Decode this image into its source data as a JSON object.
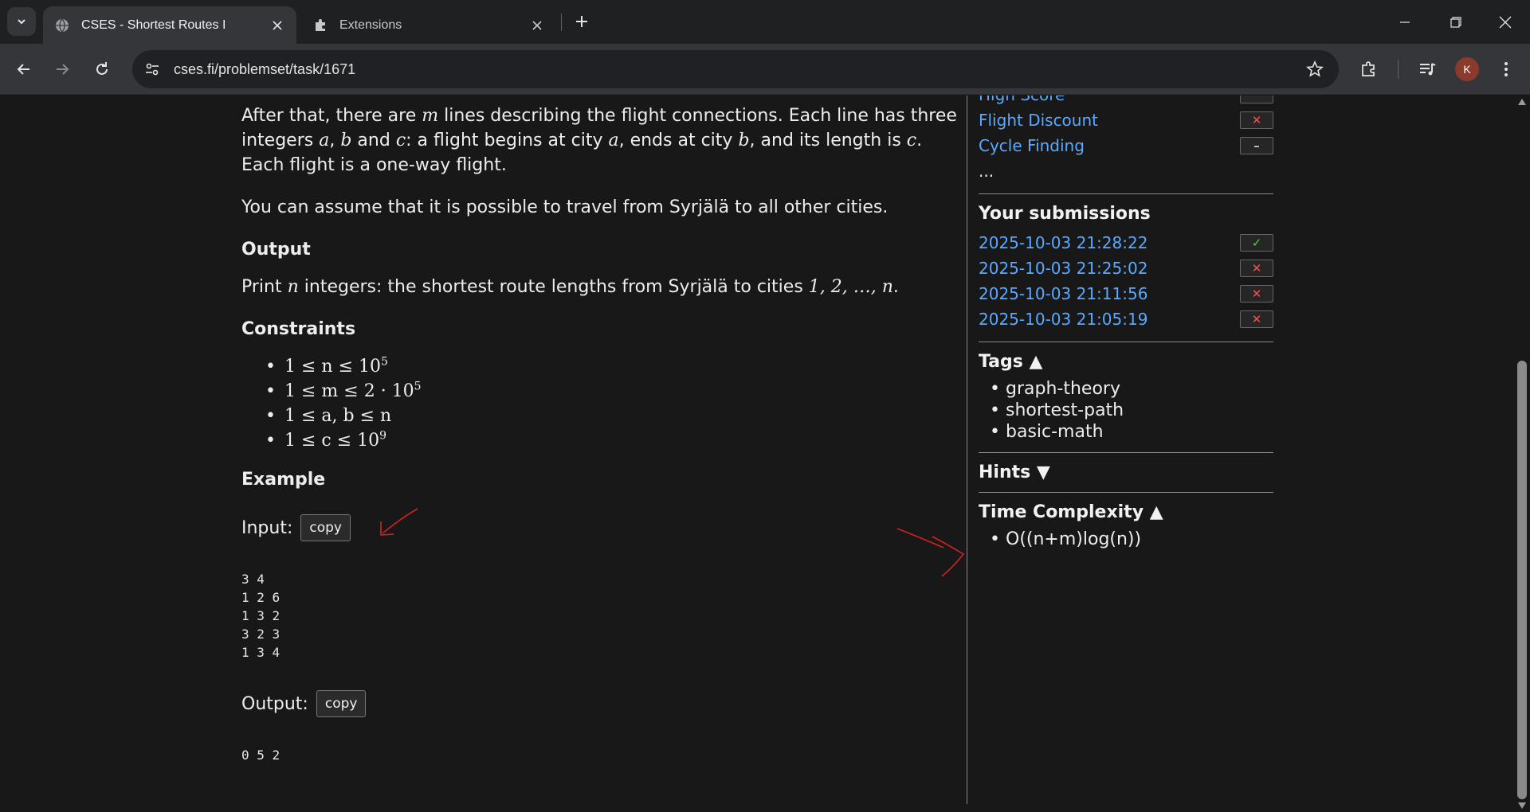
{
  "browser": {
    "tabs": [
      {
        "title": "CSES - Shortest Routes I",
        "active": true
      },
      {
        "title": "Extensions",
        "active": false
      }
    ],
    "url": "cses.fi/problemset/task/1671",
    "profile_initial": "K"
  },
  "content": {
    "para1_a": "After that, there are ",
    "para1_m": "m",
    "para1_b": " lines describing the flight connections. Each line has three integers ",
    "para1_va": "a",
    "para1_c": ", ",
    "para1_vb": "b",
    "para1_d": " and ",
    "para1_vc": "c",
    "para1_e": ": a flight begins at city ",
    "para1_va2": "a",
    "para1_f": ", ends at city ",
    "para1_vb2": "b",
    "para1_g": ", and its length is ",
    "para1_vc2": "c",
    "para1_h": ". Each flight is a one-way flight.",
    "para2": "You can assume that it is possible to travel from Syrjälä to all other cities.",
    "output_heading": "Output",
    "output_a": "Print ",
    "output_n": "n",
    "output_b": " integers: the shortest route lengths from Syrjälä to cities ",
    "output_seq": "1, 2, …, n",
    "output_c": ".",
    "constraints_heading": "Constraints",
    "constraints": [
      {
        "text": "1 ≤ n ≤ 10",
        "sup": "5"
      },
      {
        "text": "1 ≤ m ≤ 2 · 10",
        "sup": "5"
      },
      {
        "text": "1 ≤ a, b ≤ n",
        "sup": ""
      },
      {
        "text": "1 ≤ c ≤ 10",
        "sup": "9"
      }
    ],
    "example_heading": "Example",
    "input_label": "Input:",
    "output_label": "Output:",
    "copy_label": "copy",
    "input_sample": "3 4\n1 2 6\n1 3 2\n3 2 3\n1 3 4",
    "output_sample": "0 5 2"
  },
  "sidebar": {
    "cut_item": "High Score",
    "related": [
      {
        "label": "Flight Discount",
        "status": "fail",
        "symbol": "✕"
      },
      {
        "label": "Cycle Finding",
        "status": "none",
        "symbol": "–"
      }
    ],
    "ellipsis": "...",
    "submissions_heading": "Your submissions",
    "submissions": [
      {
        "time": "2025-10-03 21:28:22",
        "status": "ok",
        "symbol": "✓"
      },
      {
        "time": "2025-10-03 21:25:02",
        "status": "fail",
        "symbol": "✕"
      },
      {
        "time": "2025-10-03 21:11:56",
        "status": "fail",
        "symbol": "✕"
      },
      {
        "time": "2025-10-03 21:05:19",
        "status": "fail",
        "symbol": "✕"
      }
    ],
    "tags_heading": "Tags ▲",
    "tags": [
      "graph-theory",
      "shortest-path",
      "basic-math"
    ],
    "hints_heading": "Hints ▼",
    "complexity_heading": "Time Complexity ▲",
    "complexity": [
      "O((n+m)log(n))"
    ]
  },
  "colors": {
    "link": "#5aa9ff",
    "fail": "#ff4d4d",
    "ok": "#3ddc3d",
    "annotation": "#d62020"
  }
}
